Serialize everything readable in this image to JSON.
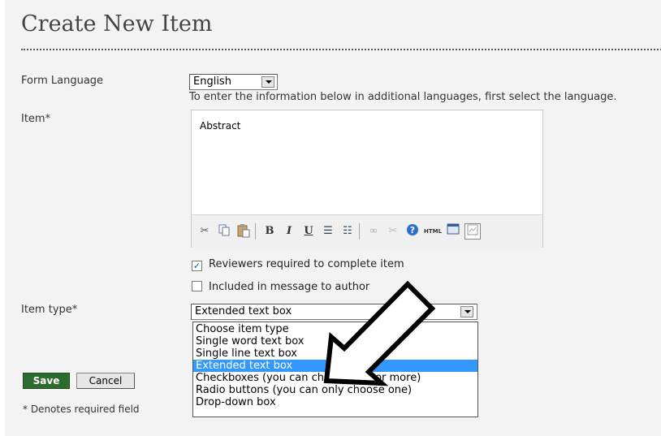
{
  "page": {
    "title": "Create New Item"
  },
  "form_language": {
    "label": "Form Language",
    "selected": "English",
    "help": "To enter the information below in additional languages, first select the language."
  },
  "item": {
    "label": "Item*",
    "text": "Abstract",
    "toolbar": [
      "cut-icon",
      "copy-icon",
      "paste-icon",
      "bold-icon",
      "italic-icon",
      "underline-icon",
      "bullet-list-icon",
      "numbered-list-icon",
      "link-icon",
      "unlink-icon",
      "help-icon",
      "html-icon",
      "fullscreen-icon",
      "image-icon"
    ]
  },
  "checkboxes": [
    {
      "label": "Reviewers required to complete item",
      "checked": true
    },
    {
      "label": "Included in message to author",
      "checked": false
    }
  ],
  "item_type": {
    "label": "Item type*",
    "selected": "Extended text box",
    "options": [
      "Choose item type",
      "Single word text box",
      "Single line text box",
      "Extended text box",
      "Checkboxes (you can choose one or more)",
      "Radio buttons (you can only choose one)",
      "Drop-down box"
    ],
    "highlighted_index": 3
  },
  "buttons": {
    "save": "Save",
    "cancel": "Cancel"
  },
  "footnote": "* Denotes required field",
  "colors": {
    "save_button": "#2e6b2e",
    "selected_option": "#3399ff",
    "panel_background": "#f3f3f3"
  }
}
